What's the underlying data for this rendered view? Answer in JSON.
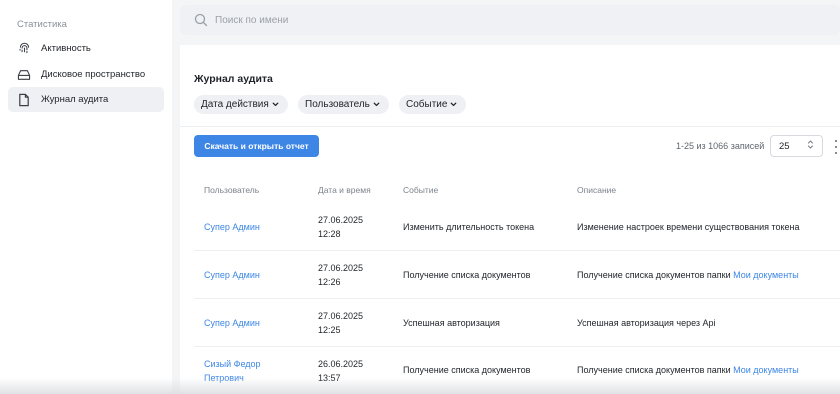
{
  "sidebar": {
    "title": "Статистика",
    "items": [
      {
        "label": "Активность",
        "icon": "fingerprint-icon"
      },
      {
        "label": "Дисковое пространство",
        "icon": "hard-drive-icon"
      },
      {
        "label": "Журнал аудита",
        "icon": "document-icon",
        "active": true
      }
    ]
  },
  "search": {
    "placeholder": "Поиск по имени",
    "value": ""
  },
  "page": {
    "title": "Журнал аудита"
  },
  "filters": [
    "Дата действия",
    "Пользователь",
    "Событие"
  ],
  "toolbar": {
    "download_label": "Скачать и открыть отчет",
    "pager_info": "1-25 из 1066 записей",
    "page_size": "25"
  },
  "table": {
    "headers": [
      "Пользователь",
      "Дата и время",
      "Событие",
      "Описание"
    ],
    "rows": [
      {
        "user_line1": "Супер Админ",
        "user_line2": "",
        "date": "27.06.2025",
        "time": "12:28",
        "event": "Изменить длительность токена",
        "description": "Изменение настроек времени существования токена",
        "description_link": ""
      },
      {
        "user_line1": "Супер Админ",
        "user_line2": "",
        "date": "27.06.2025",
        "time": "12:26",
        "event": "Получение списка документов",
        "description": "Получение списка документов папки",
        "description_link": "Мои документы"
      },
      {
        "user_line1": "Супер Админ",
        "user_line2": "",
        "date": "27.06.2025",
        "time": "12:25",
        "event": "Успешная авторизация",
        "description": "Успешная авторизация через Api",
        "description_link": ""
      },
      {
        "user_line1": "Сизый Федор",
        "user_line2": "Петрович",
        "date": "26.06.2025",
        "time": "13:57",
        "event": "Получение списка документов",
        "description": "Получение списка документов папки",
        "description_link": "Мои документы"
      }
    ]
  },
  "colors": {
    "accent": "#3d86e6",
    "text": "#1f2329",
    "muted": "#8a9099"
  }
}
